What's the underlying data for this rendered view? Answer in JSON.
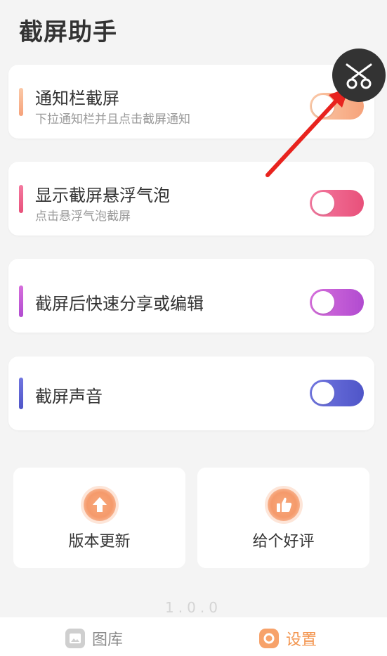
{
  "app": {
    "title": "截屏助手"
  },
  "settings": [
    {
      "title": "通知栏截屏",
      "subtitle": "下拉通知栏并且点击截屏通知",
      "enabled": false,
      "accent": "#f6a27a",
      "gradient": [
        "#fbc9a8",
        "#f6a27a"
      ]
    },
    {
      "title": "显示截屏悬浮气泡",
      "subtitle": "点击悬浮气泡截屏",
      "enabled": false,
      "accent": "#e8507a",
      "gradient": [
        "#f47aa0",
        "#e8507a"
      ]
    },
    {
      "title": "截屏后快速分享或编辑",
      "subtitle": "",
      "enabled": false,
      "accent": "#c74bd0",
      "gradient": [
        "#d66fdc",
        "#b14bd0"
      ]
    },
    {
      "title": "截屏声音",
      "subtitle": "",
      "enabled": false,
      "accent": "#5a5fd0",
      "gradient": [
        "#7176e0",
        "#4f55c8"
      ]
    }
  ],
  "actions": [
    {
      "label": "版本更新",
      "icon": "arrow-up-icon"
    },
    {
      "label": "给个好评",
      "icon": "thumbs-up-icon"
    }
  ],
  "version": "1.0.0",
  "bottom_nav": {
    "items": [
      {
        "label": "图库",
        "icon": "gallery-icon",
        "active": false
      },
      {
        "label": "设置",
        "icon": "settings-icon",
        "active": true
      }
    ]
  },
  "floating_bubble": {
    "icon": "scissors-icon"
  },
  "colors": {
    "active_nav": "#f3954f",
    "inactive_nav": "#8a8a8a",
    "annotation_arrow": "#e8231e"
  }
}
